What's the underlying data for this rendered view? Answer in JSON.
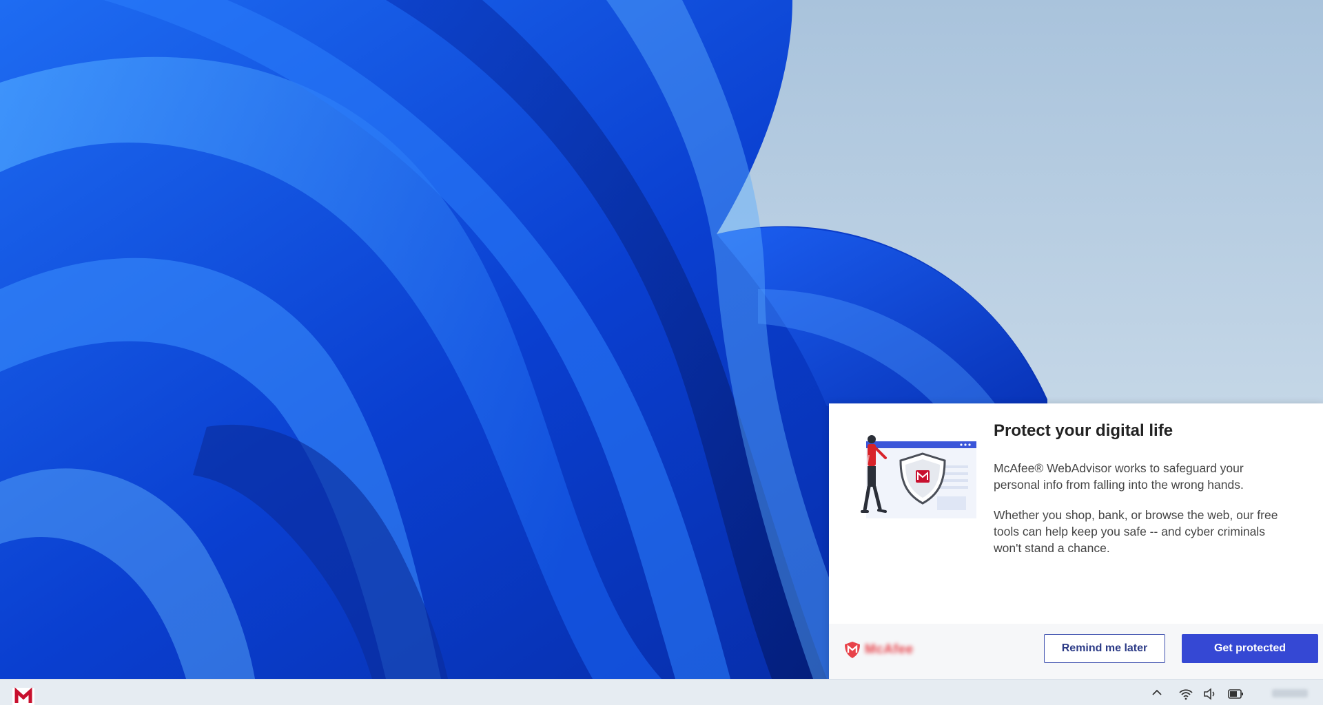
{
  "toast": {
    "title": "Protect your digital life",
    "body_1": "McAfee® WebAdvisor works to safeguard your personal info from falling into the wrong hands.",
    "body_2": "Whether you shop, bank, or browse the web, our free tools can help keep you safe -- and cyber criminals won't stand a chance.",
    "brand_name": "McAfee",
    "buttons": {
      "remind_later": "Remind me later",
      "get_protected": "Get protected"
    }
  },
  "colors": {
    "brand_red": "#c8102e",
    "primary_button": "#3548d4",
    "secondary_border": "#3d4fae",
    "wallpaper_blue": "#0a4de0"
  },
  "icons": {
    "illustration": "person-with-shield-illustration",
    "brand": "mcafee-shield-icon",
    "taskbar_app": "mcafee-m-icon",
    "tray": [
      "chevron-up-icon",
      "wifi-icon",
      "volume-icon",
      "battery-icon"
    ]
  }
}
